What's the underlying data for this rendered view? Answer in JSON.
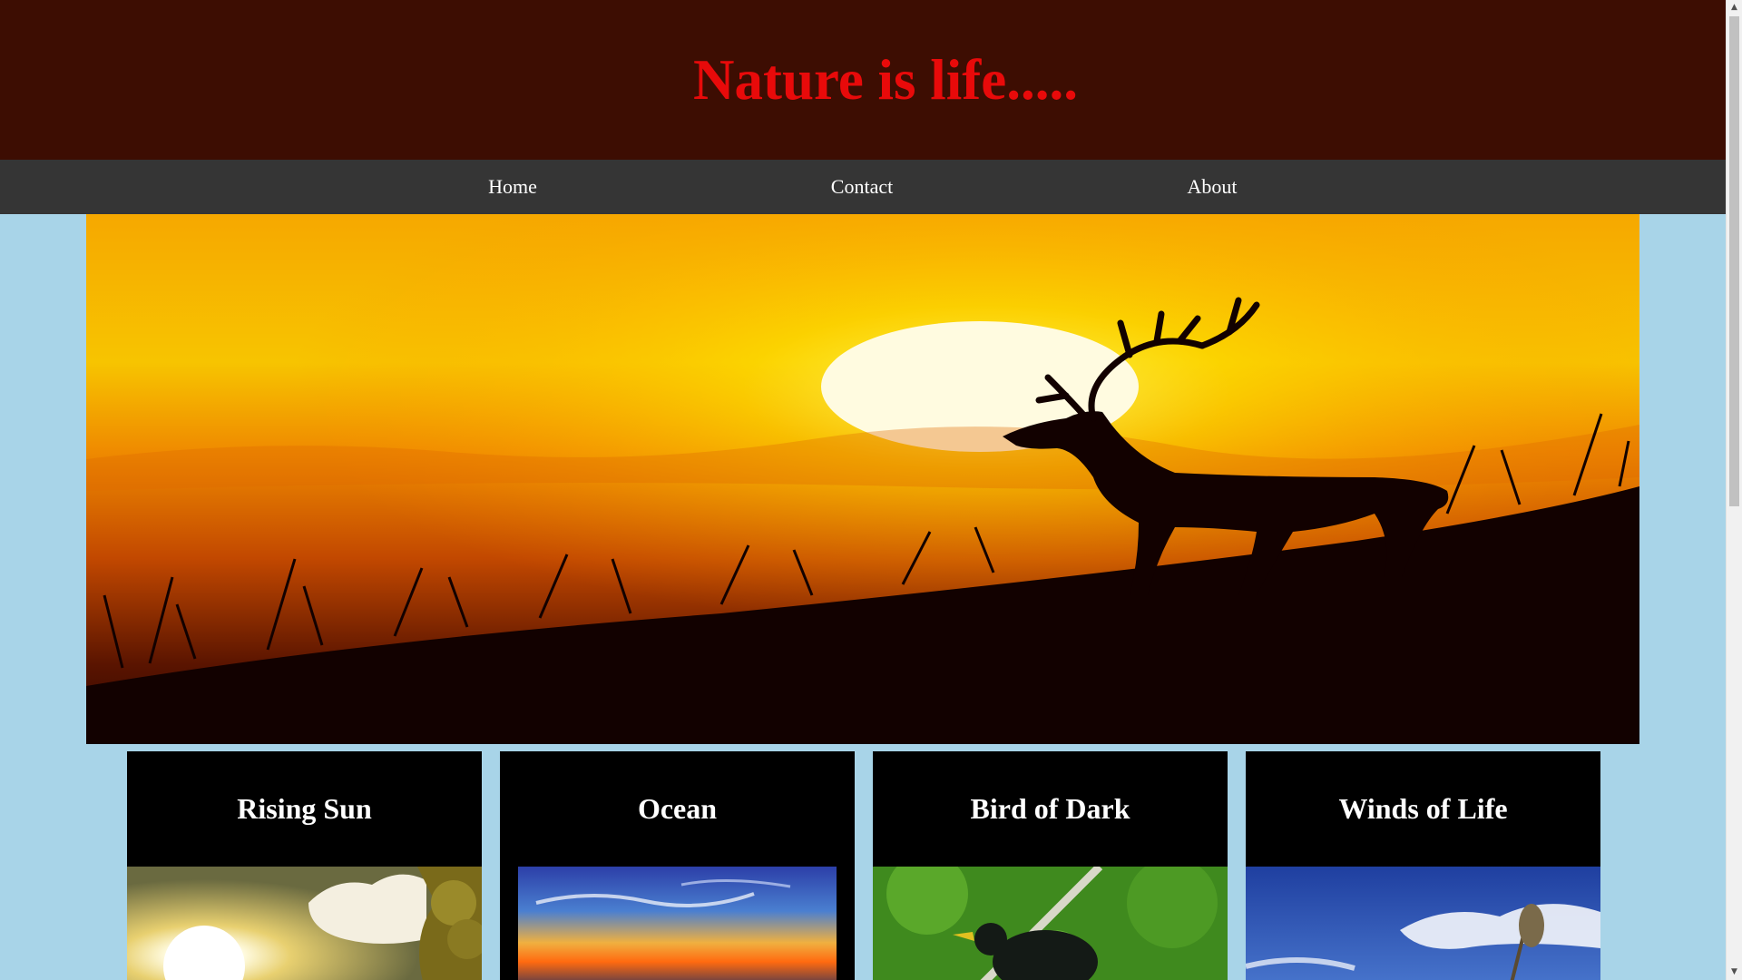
{
  "header": {
    "title": "Nature is life....."
  },
  "nav": {
    "items": [
      {
        "label": "Home"
      },
      {
        "label": "Contact"
      },
      {
        "label": "About"
      }
    ]
  },
  "hero": {
    "image": "deer-sunset-silhouette"
  },
  "cards": [
    {
      "title": "Rising Sun",
      "image": "sun-clouds-tree"
    },
    {
      "title": "Ocean",
      "image": "ocean-sunset"
    },
    {
      "title": "Bird of Dark",
      "image": "starling-on-branch"
    },
    {
      "title": "Winds of Life",
      "image": "blue-sky-grass"
    }
  ],
  "colors": {
    "page_background": "#a8d4e8",
    "header_background": "#3d0d02",
    "title_color": "#e80a0a",
    "nav_background": "#353535",
    "card_background": "#000000"
  },
  "scrollbar": {
    "up_icon": "triangle-up-icon",
    "down_icon": "triangle-down-icon"
  }
}
